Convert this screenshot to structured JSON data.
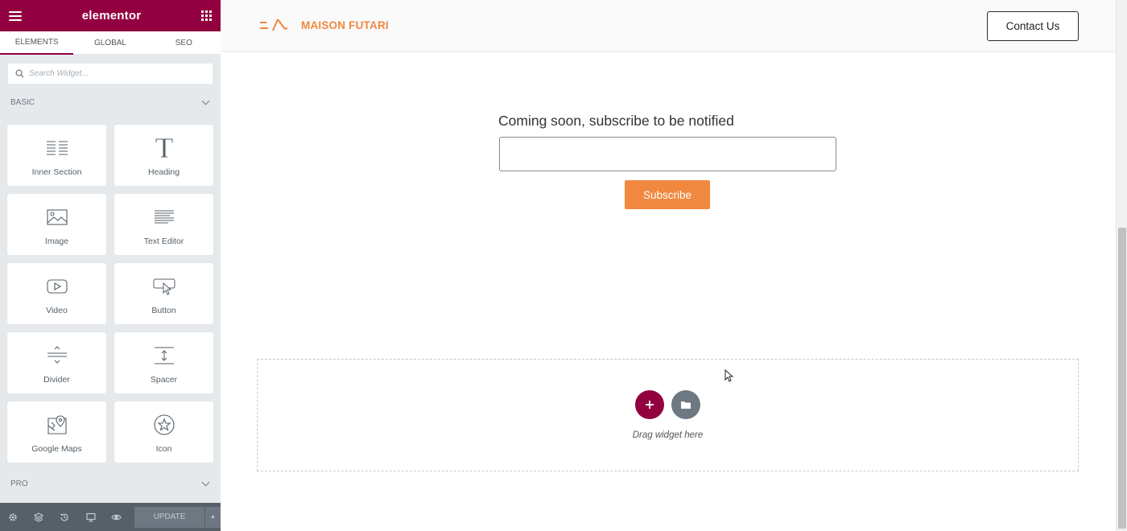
{
  "panel": {
    "logo": "elementor",
    "tabs": [
      {
        "label": "ELEMENTS",
        "active": true
      },
      {
        "label": "GLOBAL",
        "active": false
      },
      {
        "label": "SEO",
        "active": false
      }
    ],
    "search_placeholder": "Search Widget...",
    "categories": {
      "basic": "BASIC",
      "pro": "PRO"
    },
    "widgets": [
      {
        "label": "Inner Section",
        "icon": "inner-section-icon"
      },
      {
        "label": "Heading",
        "icon": "heading-icon"
      },
      {
        "label": "Image",
        "icon": "image-icon"
      },
      {
        "label": "Text Editor",
        "icon": "text-editor-icon"
      },
      {
        "label": "Video",
        "icon": "video-icon"
      },
      {
        "label": "Button",
        "icon": "button-icon"
      },
      {
        "label": "Divider",
        "icon": "divider-icon"
      },
      {
        "label": "Spacer",
        "icon": "spacer-icon"
      },
      {
        "label": "Google Maps",
        "icon": "google-maps-icon"
      },
      {
        "label": "Icon",
        "icon": "star-icon"
      }
    ],
    "footer": {
      "update_label": "UPDATE"
    }
  },
  "preview": {
    "brand_name": "MAISON FUTARI",
    "contact_label": "Contact Us",
    "heading": "Coming soon, subscribe to be notified",
    "email_value": "",
    "subscribe_label": "Subscribe",
    "drop_text": "Drag widget here"
  },
  "colors": {
    "brand": "#93003f",
    "accent": "#f0883f",
    "panel_bg": "#e6e9ec",
    "footer_bg": "#556068"
  }
}
